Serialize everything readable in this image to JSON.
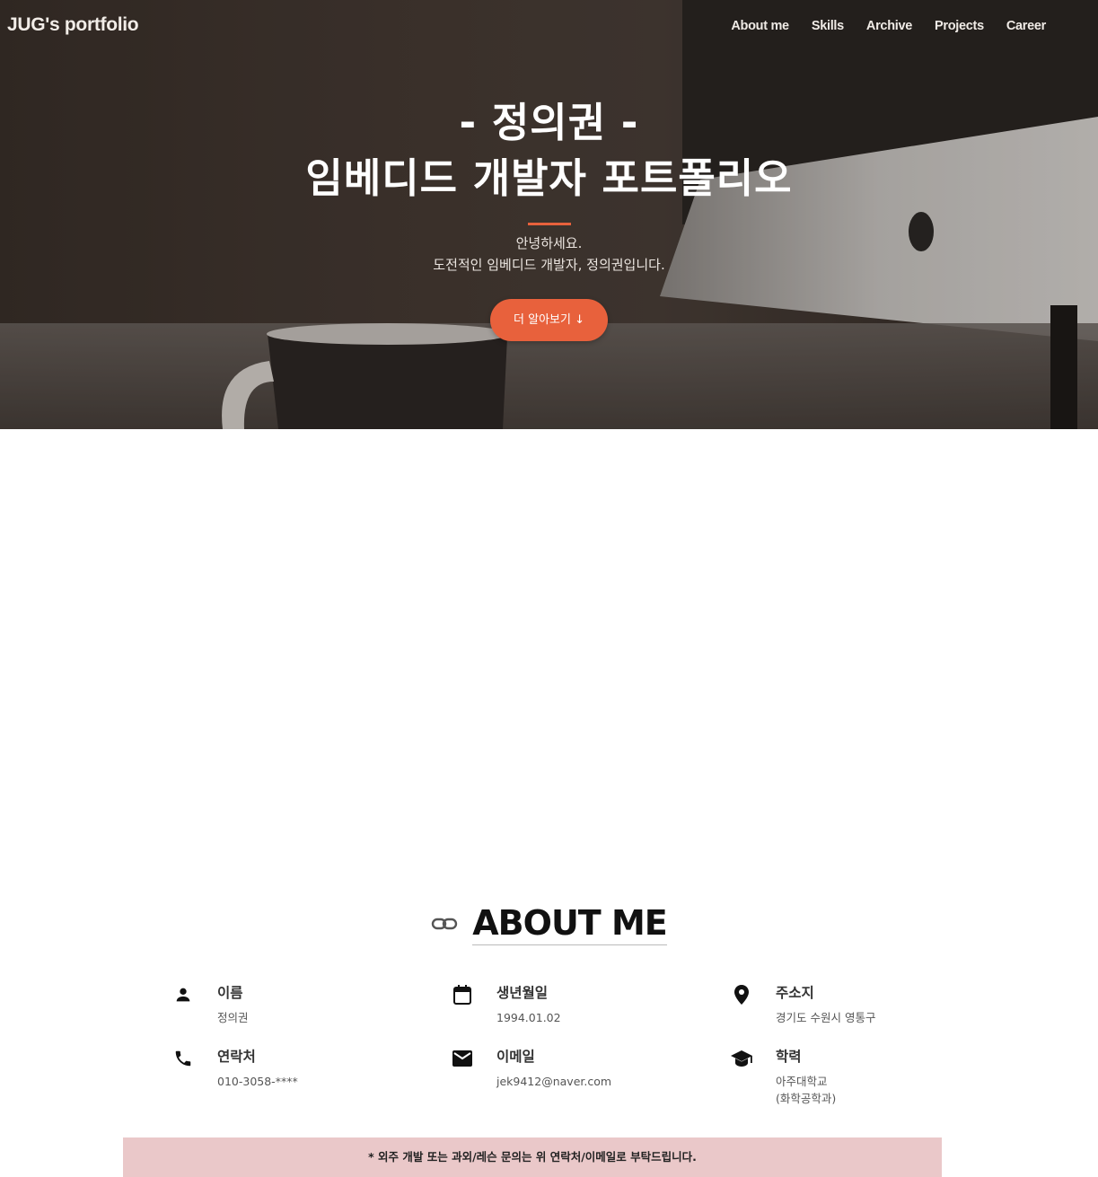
{
  "nav": {
    "brand": "JUG's portfolio",
    "items": [
      "About me",
      "Skills",
      "Archive",
      "Projects",
      "Career"
    ]
  },
  "hero": {
    "title_line1": "- 정의권 -",
    "title_line2": "임베디드 개발자 포트폴리오",
    "subtitle_line1": "안녕하세요.",
    "subtitle_line2": "도전적인 임베디드 개발자, 정의권입니다.",
    "button_label": "더 알아보기 ↓"
  },
  "about": {
    "title": "ABOUT ME",
    "items": [
      {
        "icon": "person-icon",
        "label": "이름",
        "value": "정의권"
      },
      {
        "icon": "calendar-icon",
        "label": "생년월일",
        "value": "1994.01.02"
      },
      {
        "icon": "location-pin-icon",
        "label": "주소지",
        "value": "경기도 수원시 영통구"
      },
      {
        "icon": "phone-icon",
        "label": "연락처",
        "value": "010-3058-****"
      },
      {
        "icon": "mail-icon",
        "label": "이메일",
        "value": "jek9412@naver.com"
      },
      {
        "icon": "graduation-cap-icon",
        "label": "학력",
        "value": "아주대학교",
        "value2": "(화학공학과)"
      }
    ],
    "notice": "* 외주 개발 또는 과외/레슨 문의는 위 연락처/이메일로 부탁드립니다."
  },
  "colors": {
    "accent": "#e8613c",
    "notice_bg": "#eac8c9"
  }
}
